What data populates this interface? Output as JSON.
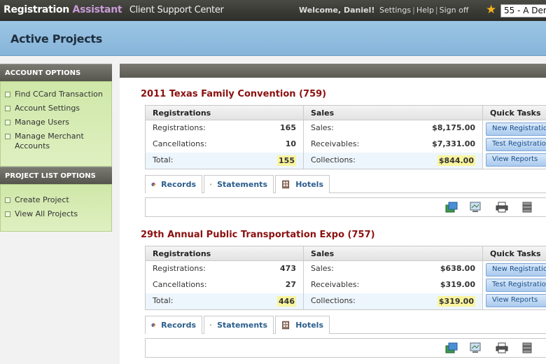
{
  "header": {
    "logo_main": "Registration",
    "logo_accent": "Assistant",
    "logo_sub": "Client Support Center",
    "welcome": "Welcome, Daniel!",
    "links": [
      "Settings",
      "Help",
      "Sign off"
    ],
    "project_select": "55 - A Der"
  },
  "page": {
    "title": "Active Projects"
  },
  "sidebar": {
    "account_heading": "ACCOUNT OPTIONS",
    "account_items": [
      "Find CCard Transaction",
      "Account Settings",
      "Manage Users",
      "Manage Merchant Accounts"
    ],
    "project_heading": "PROJECT LIST OPTIONS",
    "project_items": [
      "Create Project",
      "View All Projects"
    ]
  },
  "labels": {
    "registrations_head": "Registrations",
    "sales_head": "Sales",
    "quick_tasks_head": "Quick Tasks",
    "registrations": "Registrations:",
    "cancellations": "Cancellations:",
    "total": "Total:",
    "sales": "Sales:",
    "receivables": "Receivables:",
    "collections": "Collections:",
    "btn_new": "New Registration",
    "btn_test": "Test Registration",
    "btn_reports": "View Reports",
    "tab_records": "Records",
    "tab_statements": "Statements",
    "tab_hotels": "Hotels"
  },
  "projects": [
    {
      "title": "2011 Texas Family Convention (759)",
      "registrations": "165",
      "cancellations": "10",
      "total": "155",
      "sales": "$8,175.00",
      "receivables": "$7,331.00",
      "collections": "$844.00"
    },
    {
      "title": "29th Annual Public Transportation Expo (757)",
      "registrations": "473",
      "cancellations": "27",
      "total": "446",
      "sales": "$638.00",
      "receivables": "$319.00",
      "collections": "$319.00"
    }
  ],
  "colors": {
    "accent": "#8b1010",
    "highlight": "#f9f59e",
    "sidebar_green": "#cfe7a8"
  }
}
